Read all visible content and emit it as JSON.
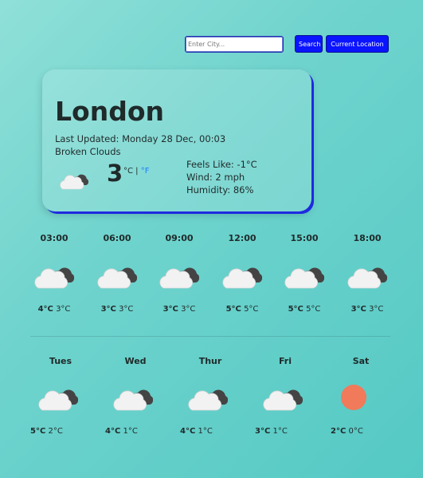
{
  "search": {
    "placeholder": "Enter City...",
    "value": "",
    "search_label": "Search",
    "location_label": "Current Location"
  },
  "current": {
    "city": "London",
    "updated": "Last Updated: Monday 28 Dec, 00:03",
    "description": "Broken Clouds",
    "temp": "3",
    "unit_c": "°C",
    "unit_sep": " | ",
    "unit_f": "°F",
    "feels": "Feels Like: -1°C",
    "wind": "Wind: 2 mph",
    "humidity": "Humidity: 86%",
    "icon": "broken-clouds-icon"
  },
  "hourly": [
    {
      "time": "03:00",
      "hi": "4°C",
      "lo": "3°C",
      "icon": "broken-clouds-icon"
    },
    {
      "time": "06:00",
      "hi": "3°C",
      "lo": "3°C",
      "icon": "broken-clouds-icon"
    },
    {
      "time": "09:00",
      "hi": "3°C",
      "lo": "3°C",
      "icon": "broken-clouds-icon"
    },
    {
      "time": "12:00",
      "hi": "5°C",
      "lo": "5°C",
      "icon": "broken-clouds-icon"
    },
    {
      "time": "15:00",
      "hi": "5°C",
      "lo": "5°C",
      "icon": "broken-clouds-icon"
    },
    {
      "time": "18:00",
      "hi": "3°C",
      "lo": "3°C",
      "icon": "broken-clouds-icon"
    }
  ],
  "daily": [
    {
      "day": "Tues",
      "hi": "5°C",
      "lo": "2°C",
      "icon": "broken-clouds-icon"
    },
    {
      "day": "Wed",
      "hi": "4°C",
      "lo": "1°C",
      "icon": "broken-clouds-icon"
    },
    {
      "day": "Thur",
      "hi": "4°C",
      "lo": "1°C",
      "icon": "broken-clouds-icon"
    },
    {
      "day": "Fri",
      "hi": "3°C",
      "lo": "1°C",
      "icon": "broken-clouds-icon"
    },
    {
      "day": "Sat",
      "hi": "2°C",
      "lo": "0°C",
      "icon": "clear-sun-icon"
    }
  ],
  "colors": {
    "accent": "#0a14ff",
    "sun": "#f07a5a",
    "f_link": "#1a7cff"
  }
}
